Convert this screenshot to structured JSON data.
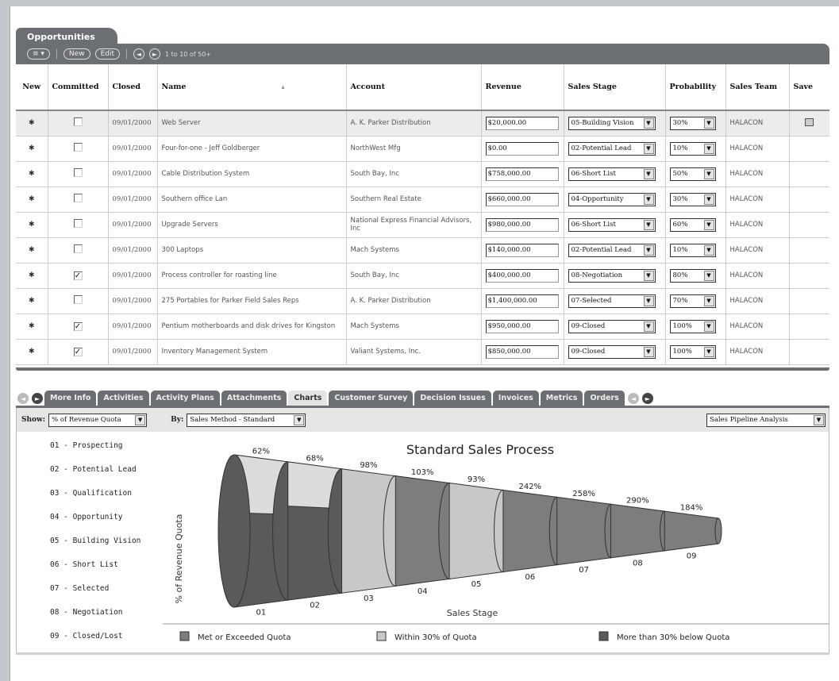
{
  "opportunities": {
    "tab_label": "Opportunities",
    "toolbar": {
      "menu_label": "≡ ▾",
      "new_label": "New",
      "edit_label": "Edit",
      "prev_icon": "◄",
      "next_icon": "►",
      "record_count": "1 to 10 of 50+"
    },
    "columns": [
      "New",
      "Committed",
      "Closed",
      "Name",
      "Account",
      "Revenue",
      "Sales Stage",
      "Probability",
      "Sales Team",
      "Save"
    ],
    "sort_indicator": "▴",
    "rows": [
      {
        "committed": false,
        "closed": "09/01/2000",
        "name": "Web Server",
        "account": "A. K. Parker Distribution",
        "revenue": "$20,000.00",
        "stage": "05-Building Vision",
        "probability": "30%",
        "team": "HALACON"
      },
      {
        "committed": false,
        "closed": "09/01/2000",
        "name": "Four-for-one - Jeff Goldberger",
        "account": "NorthWest Mfg",
        "revenue": "$0.00",
        "stage": "02-Potential Lead",
        "probability": "10%",
        "team": "HALACON"
      },
      {
        "committed": false,
        "closed": "09/01/2000",
        "name": "Cable Distribution System",
        "account": "South Bay, Inc",
        "revenue": "$758,000.00",
        "stage": "06-Short List",
        "probability": "50%",
        "team": "HALACON"
      },
      {
        "committed": false,
        "closed": "09/01/2000",
        "name": "Southern office Lan",
        "account": "Southern Real Estate",
        "revenue": "$660,000.00",
        "stage": "04-Opportunity",
        "probability": "30%",
        "team": "HALACON"
      },
      {
        "committed": false,
        "closed": "09/01/2000",
        "name": "Upgrade Servers",
        "account": "National Express Financial Advisors, Inc",
        "revenue": "$980,000.00",
        "stage": "06-Short List",
        "probability": "60%",
        "team": "HALACON"
      },
      {
        "committed": false,
        "closed": "09/01/2000",
        "name": "300 Laptops",
        "account": "Mach Systems",
        "revenue": "$140,000.00",
        "stage": "02-Potential Lead",
        "probability": "10%",
        "team": "HALACON"
      },
      {
        "committed": true,
        "closed": "09/01/2000",
        "name": "Process controller for roasting line",
        "account": "South Bay, Inc",
        "revenue": "$400,000.00",
        "stage": "08-Negotiation",
        "probability": "80%",
        "team": "HALACON"
      },
      {
        "committed": false,
        "closed": "09/01/2000",
        "name": "275 Portables for Parker Field Sales Reps",
        "account": "A. K. Parker Distribution",
        "revenue": "$1,400,000.00",
        "stage": "07-Selected",
        "probability": "70%",
        "team": "HALACON"
      },
      {
        "committed": true,
        "closed": "09/01/2000",
        "name": "Pentium motherboards and disk drives for Kingston",
        "account": "Mach Systems",
        "revenue": "$950,000.00",
        "stage": "09-Closed",
        "probability": "100%",
        "team": "HALACON"
      },
      {
        "committed": true,
        "closed": "09/01/2000",
        "name": "Inventory Management System",
        "account": "Valiant Systems, Inc.",
        "revenue": "$850,000.00",
        "stage": "09-Closed",
        "probability": "100%",
        "team": "HALACON"
      }
    ]
  },
  "tabs": {
    "prev_icon": "►",
    "next_icon": "►",
    "items": [
      "More Info",
      "Activities",
      "Activity Plans",
      "Attachments",
      "Charts",
      "Customer Survey",
      "Decision Issues",
      "Invoices",
      "Metrics",
      "Orders"
    ],
    "active": "Charts"
  },
  "chart_controls": {
    "show_label": "Show:",
    "show_value": "% of Revenue Quota",
    "by_label": "By:",
    "by_value": "Sales Method - Standard",
    "analysis_value": "Sales Pipeline Analysis"
  },
  "stage_list": [
    "01 - Prospecting",
    "02 - Potential Lead",
    "03 - Qualification",
    "04 - Opportunity",
    "05 - Building Vision",
    "06 - Short List",
    "07 - Selected",
    "08 - Negotiation",
    "09 - Closed/Lost"
  ],
  "chart_data": {
    "type": "bar",
    "title": "Standard Sales Process",
    "xlabel": "Sales Stage",
    "ylabel": "% of Revenue Quota",
    "categories": [
      "01",
      "02",
      "03",
      "04",
      "05",
      "06",
      "07",
      "08",
      "09"
    ],
    "values": [
      62,
      68,
      98,
      103,
      93,
      242,
      258,
      290,
      184
    ],
    "value_labels": [
      "62%",
      "68%",
      "98%",
      "103%",
      "93%",
      "242%",
      "258%",
      "290%",
      "184%"
    ],
    "status": [
      "below",
      "below",
      "within",
      "met",
      "within",
      "met",
      "met",
      "met",
      "met"
    ],
    "legend": [
      {
        "key": "met",
        "label": "Met or Exceeded Quota",
        "color": "#7d7d7d"
      },
      {
        "key": "within",
        "label": "Within 30% of Quota",
        "color": "#c8c8c8"
      },
      {
        "key": "below",
        "label": "More than 30% below Quota",
        "color": "#5a5a5a"
      }
    ]
  }
}
